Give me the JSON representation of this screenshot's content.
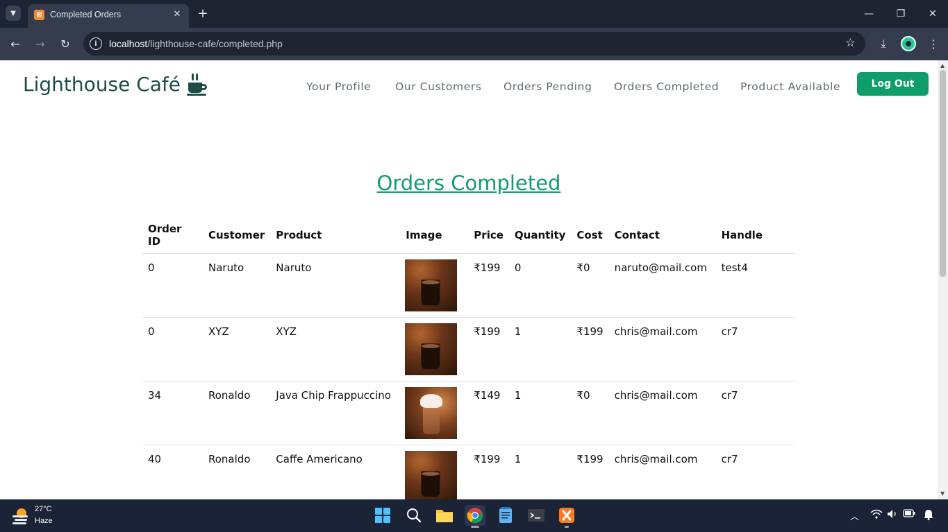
{
  "browser": {
    "tab_title": "Completed Orders",
    "url_host": "localhost",
    "url_path": "/lighthouse-cafe/completed.php"
  },
  "site": {
    "brand": "Lighthouse Café",
    "nav": {
      "profile": "Your Profile",
      "customers": "Our Customers",
      "pending": "Orders Pending",
      "completed": "Orders Completed",
      "products": "Product Available"
    },
    "logout_label": "Log Out",
    "accent_color": "#0f9d6b",
    "brand_color": "#1e4d45"
  },
  "page": {
    "heading": "Orders Completed"
  },
  "table": {
    "headers": [
      "Order ID",
      "Customer",
      "Product",
      "Image",
      "Price",
      "Quantity",
      "Cost",
      "Contact",
      "Handle"
    ],
    "rows": [
      {
        "order_id": "0",
        "customer": "Naruto",
        "product": "Naruto",
        "image": "coffee-cup",
        "price": "₹199",
        "quantity": "0",
        "cost": "₹0",
        "contact": "naruto@mail.com",
        "handle": "test4"
      },
      {
        "order_id": "0",
        "customer": "XYZ",
        "product": "XYZ",
        "image": "coffee-cup",
        "price": "₹199",
        "quantity": "1",
        "cost": "₹199",
        "contact": "chris@mail.com",
        "handle": "cr7"
      },
      {
        "order_id": "34",
        "customer": "Ronaldo",
        "product": "Java Chip Frappuccino",
        "image": "frappuccino",
        "price": "₹149",
        "quantity": "1",
        "cost": "₹0",
        "contact": "chris@mail.com",
        "handle": "cr7"
      },
      {
        "order_id": "40",
        "customer": "Ronaldo",
        "product": "Caffe Americano",
        "image": "coffee-cup",
        "price": "₹199",
        "quantity": "1",
        "cost": "₹199",
        "contact": "chris@mail.com",
        "handle": "cr7"
      }
    ]
  },
  "taskbar": {
    "temperature": "27°C",
    "condition": "Haze"
  }
}
